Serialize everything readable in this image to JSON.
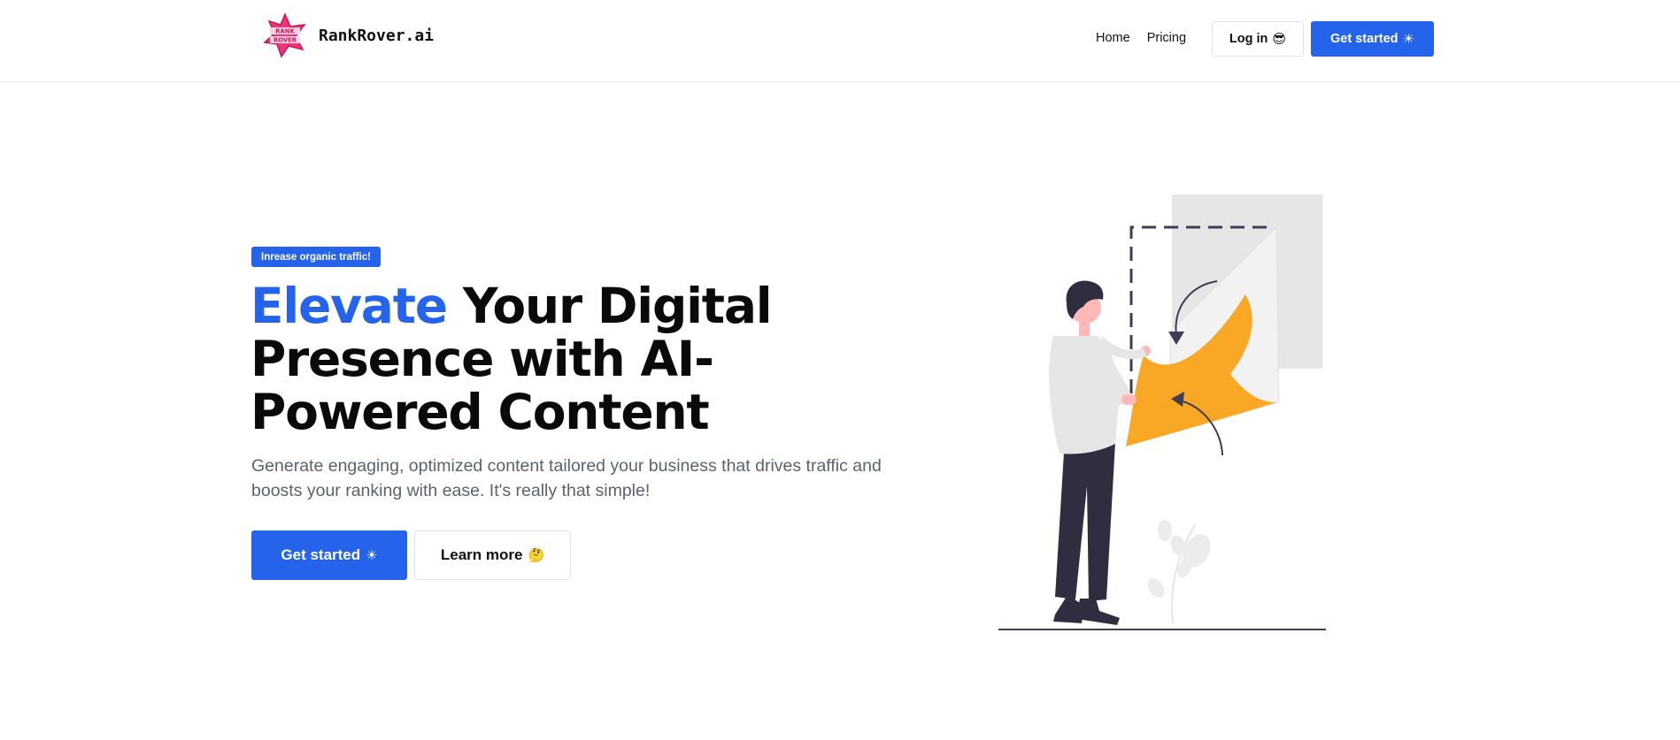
{
  "header": {
    "brand_name": "RankRover.ai",
    "logo_text": "RANK ROVER",
    "nav": [
      {
        "label": "Home"
      },
      {
        "label": "Pricing"
      }
    ],
    "login_label": "Log in",
    "login_icon": "sunglasses-emoji",
    "get_started_label": "Get started",
    "get_started_icon": "sun-emoji"
  },
  "hero": {
    "badge": "Inrease organic traffic!",
    "title_accent": "Elevate",
    "title_rest": "Your Digital Presence with AI-Powered Content",
    "subtitle": "Generate engaging, optimized content tailored your business that drives traffic and boosts your ranking with ease. It's really that simple!",
    "primary_cta": "Get started",
    "primary_cta_icon": "sun-emoji",
    "secondary_cta": "Learn more",
    "secondary_cta_icon": "thinking-emoji"
  },
  "colors": {
    "primary": "#2563eb",
    "accent_orange": "#f9a826",
    "text_dark": "#0a0a0a",
    "text_muted": "#5b616e",
    "logo_pink": "#f0357a"
  }
}
